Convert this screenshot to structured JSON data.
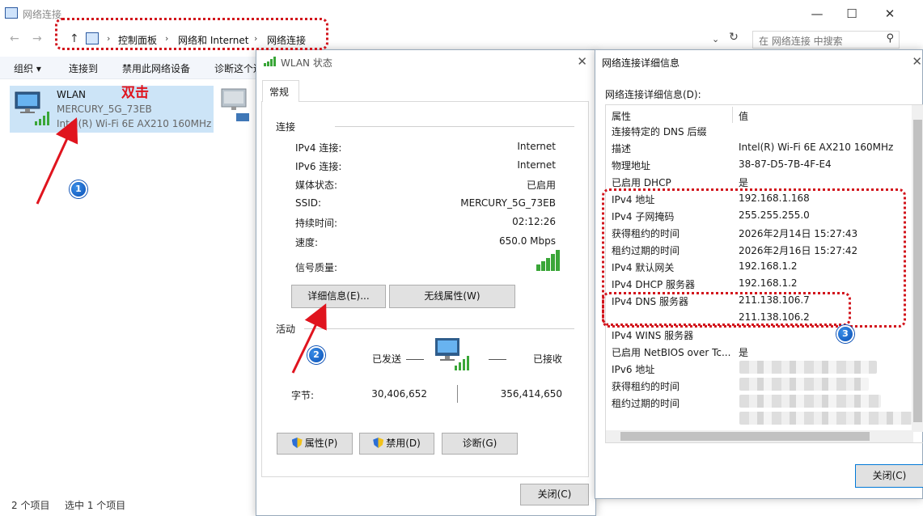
{
  "explorer": {
    "title": "网络连接",
    "breadcrumb": [
      "控制面板",
      "网络和 Internet",
      "网络连接"
    ],
    "search_placeholder": "在 网络连接 中搜索",
    "commands": [
      "组织 ▾",
      "连接到",
      "禁用此网络设备",
      "诊断这个连"
    ],
    "wlan": {
      "name": "WLAN",
      "ssid": "MERCURY_5G_73EB",
      "adapter": "Intel(R) Wi-Fi 6E AX210 160MHz"
    },
    "status": {
      "items": "2 个项目",
      "selected": "选中 1 个项目"
    }
  },
  "annotation": {
    "double_click": "双击",
    "badges": [
      "1",
      "2",
      "3"
    ]
  },
  "wlan_dialog": {
    "title": "WLAN 状态",
    "tab": "常规",
    "connection_group": "连接",
    "connection": [
      {
        "label": "IPv4 连接:",
        "value": "Internet"
      },
      {
        "label": "IPv6 连接:",
        "value": "Internet"
      },
      {
        "label": "媒体状态:",
        "value": "已启用"
      },
      {
        "label": "SSID:",
        "value": "MERCURY_5G_73EB"
      },
      {
        "label": "持续时间:",
        "value": "02:12:26"
      },
      {
        "label": "速度:",
        "value": "650.0 Mbps"
      }
    ],
    "signal_label": "信号质量:",
    "details_button": "详细信息(E)...",
    "wireless_button": "无线属性(W)",
    "activity_group": "活动",
    "sent_label": "已发送",
    "received_label": "已接收",
    "bytes_label": "字节:",
    "bytes_sent": "30,406,652",
    "bytes_received": "356,414,650",
    "properties_button": "属性(P)",
    "disable_button": "禁用(D)",
    "diagnose_button": "诊断(G)",
    "close_button": "关闭(C)"
  },
  "details_dialog": {
    "title": "网络连接详细信息",
    "label": "网络连接详细信息(D):",
    "col_property": "属性",
    "col_value": "值",
    "rows": [
      {
        "p": "连接特定的 DNS 后缀",
        "v": ""
      },
      {
        "p": "描述",
        "v": "Intel(R) Wi-Fi 6E AX210 160MHz"
      },
      {
        "p": "物理地址",
        "v": "38-87-D5-7B-4F-E4"
      },
      {
        "p": "已启用 DHCP",
        "v": "是"
      },
      {
        "p": "IPv4 地址",
        "v": "192.168.1.168"
      },
      {
        "p": "IPv4 子网掩码",
        "v": "255.255.255.0"
      },
      {
        "p": "获得租约的时间",
        "v": "2026年2月14日 15:27:43"
      },
      {
        "p": "租约过期的时间",
        "v": "2026年2月16日 15:27:42"
      },
      {
        "p": "IPv4 默认网关",
        "v": "192.168.1.2"
      },
      {
        "p": "IPv4 DHCP 服务器",
        "v": "192.168.1.2"
      },
      {
        "p": "IPv4 DNS 服务器",
        "v": "211.138.106.7"
      },
      {
        "p": "",
        "v": "211.138.106.2"
      },
      {
        "p": "IPv4 WINS 服务器",
        "v": ""
      },
      {
        "p": "已启用 NetBIOS over Tc...",
        "v": "是"
      },
      {
        "p": "IPv6 地址",
        "v": ""
      },
      {
        "p": "获得租约的时间",
        "v": ""
      },
      {
        "p": "租约过期的时间",
        "v": ""
      }
    ],
    "close_button": "关闭(C)"
  },
  "colors": {
    "annotation_red": "#d2141c",
    "selection": "#cce4f7",
    "badge_blue": "#1565d8"
  }
}
